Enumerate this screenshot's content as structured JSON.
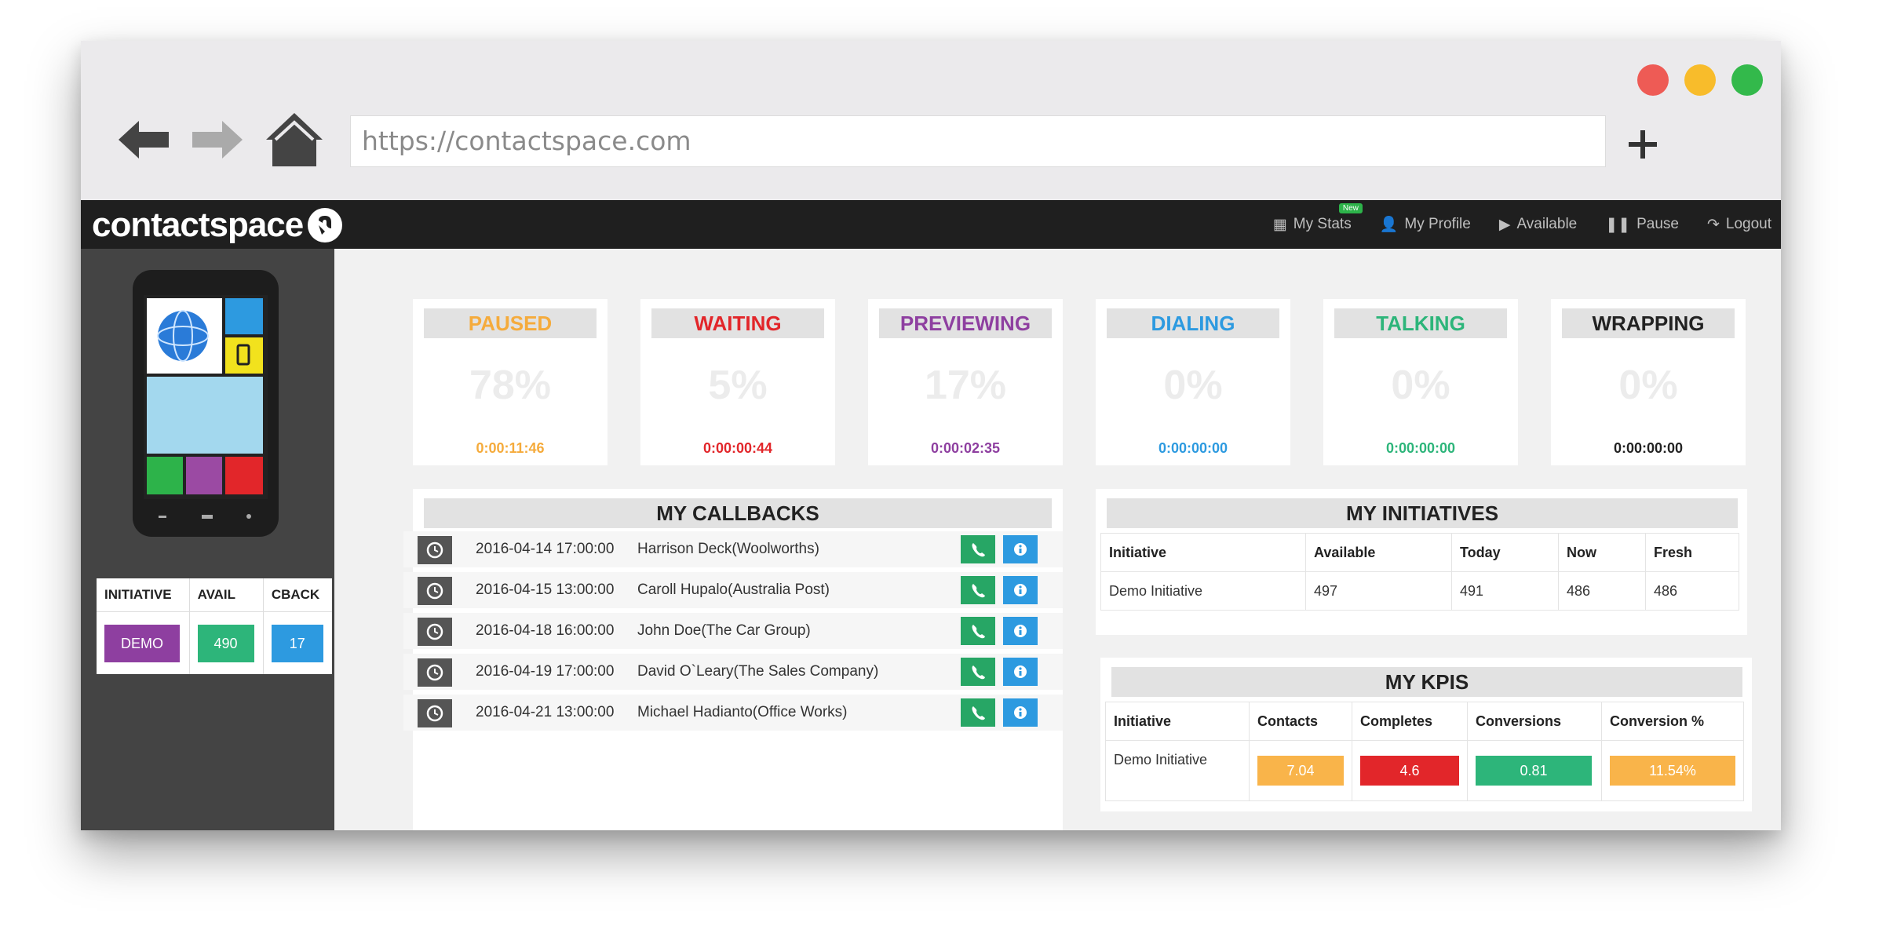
{
  "browser": {
    "url": "https://contactspace.com",
    "dots": [
      "#ee5b55",
      "#f8bc2b",
      "#33b94b"
    ]
  },
  "app": {
    "logo_text": "contactspace",
    "nav": [
      {
        "label": "My Stats",
        "icon": "stats-icon",
        "badge": "New"
      },
      {
        "label": "My Profile",
        "icon": "user-icon"
      },
      {
        "label": "Available",
        "icon": "play-icon"
      },
      {
        "label": "Pause",
        "icon": "pause-icon"
      },
      {
        "label": "Logout",
        "icon": "logout-icon"
      }
    ]
  },
  "sidebar": {
    "headers": [
      "INITIATIVE",
      "AVAIL",
      "CBACK"
    ],
    "row": {
      "initiative": "DEMO",
      "avail": "490",
      "cback": "17"
    },
    "colors": {
      "initiative": "#8e3fa0",
      "avail": "#2db57a",
      "cback": "#2d9ae0"
    }
  },
  "status_cards": [
    {
      "label": "PAUSED",
      "percent": "78%",
      "time": "0:00:11:46",
      "color": "#f5ab3c"
    },
    {
      "label": "WAITING",
      "percent": "5%",
      "time": "0:00:00:44",
      "color": "#e2262a"
    },
    {
      "label": "PREVIEWING",
      "percent": "17%",
      "time": "0:00:02:35",
      "color": "#8e3fa0"
    },
    {
      "label": "DIALING",
      "percent": "0%",
      "time": "0:00:00:00",
      "color": "#2d9ae0"
    },
    {
      "label": "TALKING",
      "percent": "0%",
      "time": "0:00:00:00",
      "color": "#2db57a"
    },
    {
      "label": "WRAPPING",
      "percent": "0%",
      "time": "0:00:00:00",
      "color": "#222222"
    }
  ],
  "callbacks": {
    "title": "MY CALLBACKS",
    "rows": [
      {
        "datetime": "2016-04-14 17:00:00",
        "name": "Harrison Deck(Woolworths)"
      },
      {
        "datetime": "2016-04-15 13:00:00",
        "name": "Caroll Hupalo(Australia Post)"
      },
      {
        "datetime": "2016-04-18 16:00:00",
        "name": "John Doe(The Car Group)"
      },
      {
        "datetime": "2016-04-19 17:00:00",
        "name": "David O`Leary(The Sales Company)"
      },
      {
        "datetime": "2016-04-21 13:00:00",
        "name": "Michael Hadianto(Office Works)"
      }
    ]
  },
  "initiatives": {
    "title": "MY INITIATIVES",
    "headers": [
      "Initiative",
      "Available",
      "Today",
      "Now",
      "Fresh"
    ],
    "rows": [
      [
        "Demo Initiative",
        "497",
        "491",
        "486",
        "486"
      ]
    ]
  },
  "kpis": {
    "title": "MY KPIS",
    "headers": [
      "Initiative",
      "Contacts",
      "Completes",
      "Conversions",
      "Conversion %"
    ],
    "row": {
      "initiative": "Demo Initiative",
      "contacts": "7.04",
      "completes": "4.6",
      "conversions": "0.81",
      "conversion_pct": "11.54%"
    },
    "colors": {
      "contacts": "#f9b44a",
      "completes": "#e2262a",
      "conversions": "#2db57a",
      "conversion_pct": "#f9b44a"
    }
  }
}
